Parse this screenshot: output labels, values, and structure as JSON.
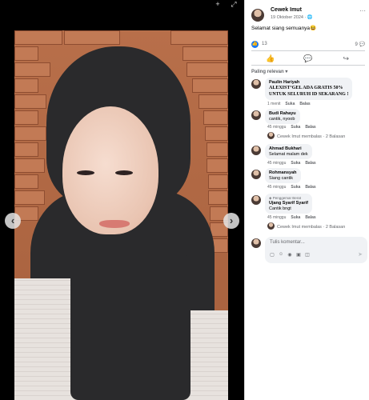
{
  "post": {
    "author": "Cewek Imut",
    "date": "19 Oktober 2024",
    "privacy_icon": "globe-icon",
    "caption": "Selamat siang semuanya😆",
    "reaction_count": "13",
    "comment_count": "9"
  },
  "actions": {
    "like_icon": "thumbs-up-icon",
    "comment_icon": "comment-icon",
    "share_icon": "share-icon"
  },
  "sort_label": "Paling relevan",
  "comments": [
    {
      "name": "Paulin Hariyah",
      "text": "ALEXIST°GEL ADA GRATIS 50% UNTUK SELURUH ID SEKARANG !",
      "text_line1": "ALEXIST°GEL ADA GRATIS 50%",
      "text_line2": "UNTUK SELURUH ID SEKARANG !",
      "time": "1 menit",
      "like": "Suka",
      "reply": "Balas"
    },
    {
      "name": "Budi Rahayu",
      "text": "cantik, nyoob",
      "time": "45 minggu",
      "like": "Suka",
      "reply": "Balas",
      "reply_summary": "Cewek Imut membalas · 2 Balasan"
    },
    {
      "name": "Ahmad Bukhari",
      "text": "Selamat malam dek",
      "time": "45 minggu",
      "like": "Suka",
      "reply": "Balas"
    },
    {
      "name": "Rohmansyah",
      "text": "Siang cantik",
      "time": "45 minggu",
      "like": "Suka",
      "reply": "Balas"
    },
    {
      "badge": "Penggemar Berat",
      "name": "Ujang Syarif Syarif",
      "text": "Cantik bngt",
      "time": "45 minggu",
      "like": "Suka",
      "reply": "Balas",
      "reply_summary": "Cewek Imut membalas · 2 Balasan"
    }
  ],
  "composer": {
    "placeholder": "Tulis komentar..."
  },
  "colors": {
    "accent": "#1877f2",
    "bubble": "#f0f2f5",
    "viewer_bg": "#000000"
  }
}
